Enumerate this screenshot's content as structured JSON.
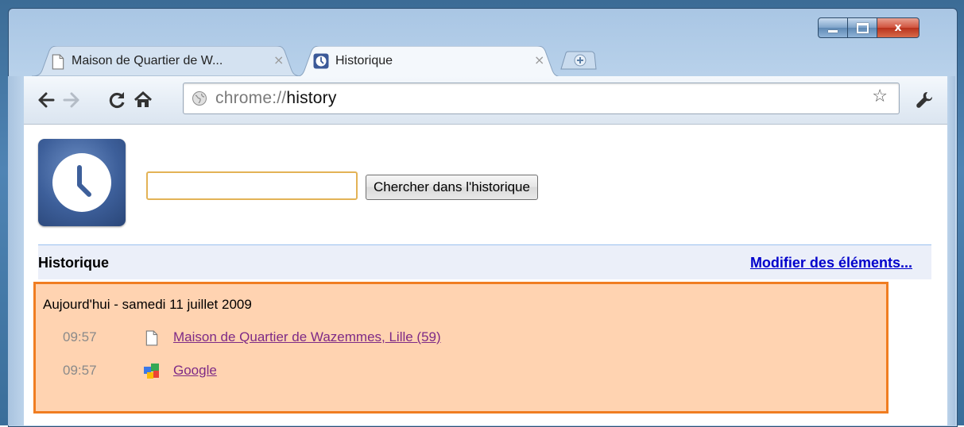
{
  "window": {
    "controls": {
      "minimize": "minimize",
      "maximize": "maximize",
      "close": "x"
    }
  },
  "tabs": [
    {
      "title": "Maison de Quartier de W...",
      "active": false,
      "icon": "page-icon"
    },
    {
      "title": "Historique",
      "active": true,
      "icon": "history-icon"
    }
  ],
  "toolbar": {
    "url_scheme": "chrome://",
    "url_path": "history"
  },
  "search": {
    "value": "",
    "button_label": "Chercher dans l'historique"
  },
  "section": {
    "title": "Historique",
    "edit_link": "Modifier des éléments..."
  },
  "day": {
    "title": "Aujourd'hui - samedi 11 juillet 2009",
    "entries": [
      {
        "time": "09:57",
        "title": "Maison de Quartier de Wazemmes, Lille (59)",
        "icon": "page-icon"
      },
      {
        "time": "09:57",
        "title": "Google",
        "icon": "google-icon"
      }
    ]
  },
  "colors": {
    "highlight_bg": "#ffd3b1",
    "highlight_border": "#f07d21",
    "link_visited": "#7e2a86",
    "link": "#0000cc",
    "header_bg": "#ebeff9"
  }
}
